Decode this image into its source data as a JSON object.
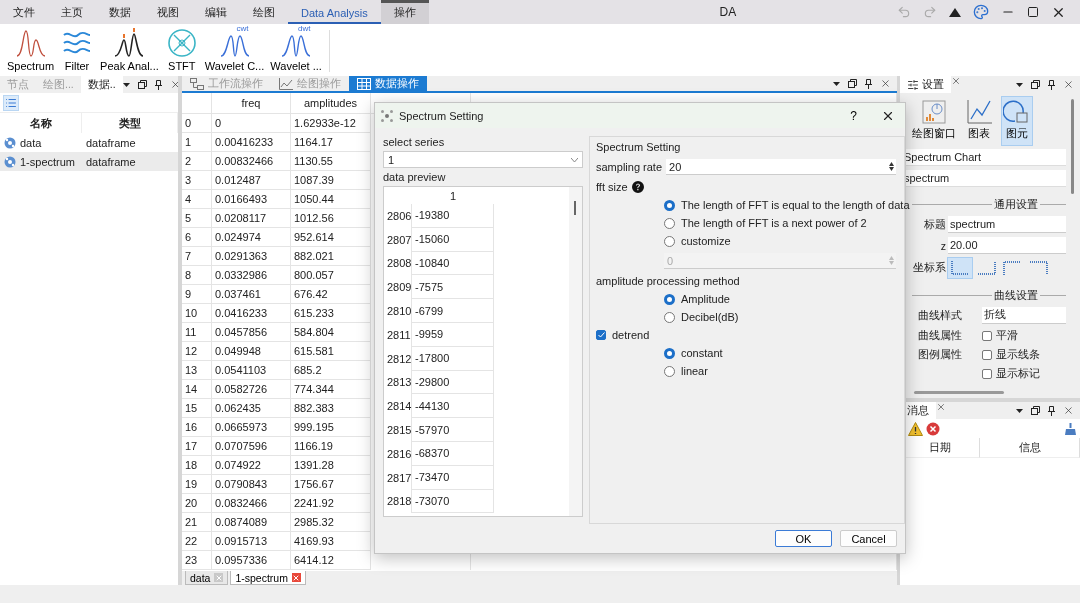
{
  "menu": [
    {
      "label": "文件",
      "selected": false,
      "contextual": false
    },
    {
      "label": "主页",
      "selected": false,
      "contextual": false
    },
    {
      "label": "数据",
      "selected": false,
      "contextual": false
    },
    {
      "label": "视图",
      "selected": false,
      "contextual": false
    },
    {
      "label": "编辑",
      "selected": false,
      "contextual": false
    },
    {
      "label": "绘图",
      "selected": false,
      "contextual": false
    },
    {
      "label": "Data Analysis",
      "selected": true,
      "contextual": false
    },
    {
      "label": "操作",
      "selected": false,
      "contextual": true
    }
  ],
  "app_title": "DA",
  "ribbon": [
    {
      "label": "Spectrum",
      "kind": "spectrum"
    },
    {
      "label": "Filter",
      "kind": "filter"
    },
    {
      "label": "Peak Anal...",
      "kind": "peaks"
    },
    {
      "label": "STFT",
      "kind": "stft"
    },
    {
      "label": "Wavelet C...",
      "kind": "wavelet",
      "badge": "cwt"
    },
    {
      "label": "Wavelet ...",
      "kind": "wavelet",
      "badge": "dwt"
    }
  ],
  "left_panel": {
    "tabs": [
      {
        "label": "节点",
        "selected": false
      },
      {
        "label": "绘图...",
        "selected": false
      },
      {
        "label": "数据..",
        "selected": true
      }
    ],
    "columns": [
      "名称",
      "类型"
    ],
    "items": [
      {
        "name": "data",
        "type": "dataframe",
        "selected": false
      },
      {
        "name": "1-spectrum",
        "type": "dataframe",
        "selected": true
      }
    ]
  },
  "workspace": {
    "tabs": [
      {
        "label": "工作流操作",
        "kind": "workflow",
        "selected": false
      },
      {
        "label": "绘图操作",
        "kind": "plot",
        "selected": false
      },
      {
        "label": "数据操作",
        "kind": "table",
        "selected": true
      }
    ],
    "table": {
      "columns": [
        "",
        "freq",
        "amplitudes"
      ],
      "rows": [
        [
          "0",
          "0",
          "1.62933e-12"
        ],
        [
          "1",
          "0.00416233",
          "1164.17"
        ],
        [
          "2",
          "0.00832466",
          "1130.55"
        ],
        [
          "3",
          "0.012487",
          "1087.39"
        ],
        [
          "4",
          "0.0166493",
          "1050.44"
        ],
        [
          "5",
          "0.0208117",
          "1012.56"
        ],
        [
          "6",
          "0.024974",
          "952.614"
        ],
        [
          "7",
          "0.0291363",
          "882.021"
        ],
        [
          "8",
          "0.0332986",
          "800.057"
        ],
        [
          "9",
          "0.037461",
          "676.42"
        ],
        [
          "10",
          "0.0416233",
          "615.233"
        ],
        [
          "11",
          "0.0457856",
          "584.804"
        ],
        [
          "12",
          "0.049948",
          "615.581"
        ],
        [
          "13",
          "0.0541103",
          "685.2"
        ],
        [
          "14",
          "0.0582726",
          "774.344"
        ],
        [
          "15",
          "0.062435",
          "882.383"
        ],
        [
          "16",
          "0.0665973",
          "999.195"
        ],
        [
          "17",
          "0.0707596",
          "1166.19"
        ],
        [
          "18",
          "0.074922",
          "1391.28"
        ],
        [
          "19",
          "0.0790843",
          "1756.67"
        ],
        [
          "20",
          "0.0832466",
          "2241.92"
        ],
        [
          "21",
          "0.0874089",
          "2985.32"
        ],
        [
          "22",
          "0.0915713",
          "4169.93"
        ],
        [
          "23",
          "0.0957336",
          "6414.12"
        ]
      ]
    },
    "sheets": [
      {
        "label": "data",
        "selected": false
      },
      {
        "label": "1-spectrum",
        "selected": true
      }
    ]
  },
  "settings_panel": {
    "tab": "设置",
    "views": [
      {
        "label": "绘图窗口",
        "kind": "window",
        "selected": false
      },
      {
        "label": "图表",
        "kind": "chart",
        "selected": false
      },
      {
        "label": "图元",
        "kind": "element",
        "selected": true
      }
    ],
    "chart_name": "Spectrum Chart",
    "element_name": "spectrum",
    "general_section": "通用设置",
    "title_label": "标题",
    "title_value": "spectrum",
    "z_label": "z",
    "z_value": "20.00",
    "coord_label": "坐标系",
    "coord_options": [
      {
        "kind": "bottom-left",
        "selected": true
      },
      {
        "kind": "bottom-right",
        "selected": false
      },
      {
        "kind": "top-left",
        "selected": false
      },
      {
        "kind": "top-right",
        "selected": false
      }
    ],
    "curve_section": "曲线设置",
    "curve_style_label": "曲线样式",
    "curve_style_value": "折线",
    "property_rows": [
      {
        "label": "曲线属性",
        "checkbox": {
          "label": "平滑",
          "checked": false
        }
      },
      {
        "label": "图例属性",
        "checkbox": {
          "label": "显示线条",
          "checked": false
        }
      },
      {
        "checkbox": {
          "label": "显示标记",
          "checked": false
        }
      }
    ]
  },
  "messages_panel": {
    "tab": "消息",
    "columns": [
      "日期",
      "信息"
    ]
  },
  "dialog": {
    "title": "Spectrum Setting",
    "help_button": "?",
    "series_label": "select series",
    "series_value": "1",
    "preview_label": "data preview",
    "preview_column": "1",
    "preview_rows": [
      [
        "2806",
        "-19380"
      ],
      [
        "2807",
        "-15060"
      ],
      [
        "2808",
        "-10840"
      ],
      [
        "2809",
        "-7575"
      ],
      [
        "2810",
        "-6799"
      ],
      [
        "2811",
        "-9959"
      ],
      [
        "2812",
        "-17800"
      ],
      [
        "2813",
        "-29800"
      ],
      [
        "2814",
        "-44130"
      ],
      [
        "2815",
        "-57970"
      ],
      [
        "2816",
        "-68370"
      ],
      [
        "2817",
        "-73470"
      ],
      [
        "2818",
        "-73070"
      ]
    ],
    "group_title": "Spectrum Setting",
    "sampling_label": "sampling rate",
    "sampling_value": "20",
    "fft_label": "fft size",
    "fft_options": [
      {
        "label": "The length of FFT is equal to the length of data",
        "selected": true
      },
      {
        "label": "The length of FFT is a next power of 2",
        "selected": false
      },
      {
        "label": "customize",
        "selected": false
      }
    ],
    "custom_size": {
      "value": "0",
      "disabled": true
    },
    "amplitude_label": "amplitude processing method",
    "amplitude_options": [
      {
        "label": "Amplitude",
        "selected": true
      },
      {
        "label": "Decibel(dB)",
        "selected": false
      }
    ],
    "detrend": {
      "label": "detrend",
      "checked": true
    },
    "detrend_options": [
      {
        "label": "constant",
        "selected": true
      },
      {
        "label": "linear",
        "selected": false
      }
    ],
    "buttons": [
      "OK",
      "Cancel"
    ]
  }
}
